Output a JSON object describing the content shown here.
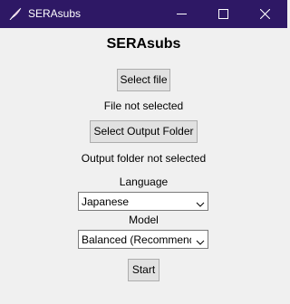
{
  "window": {
    "title": "SERAsubs"
  },
  "main": {
    "heading": "SERAsubs",
    "select_file_label": "Select file",
    "file_status": "File not selected",
    "select_output_label": "Select Output Folder",
    "output_status": "Output folder not selected",
    "language_label": "Language",
    "language_value": "Japanese",
    "model_label": "Model",
    "model_value": "Balanced (Recommended)",
    "start_label": "Start"
  },
  "colors": {
    "titlebar": "#2e1865",
    "window_bg": "#f0f0f0",
    "button_bg": "#e1e1e1"
  },
  "icons": [
    "feather-icon",
    "minimize-icon",
    "maximize-icon",
    "close-icon",
    "chevron-down-icon"
  ]
}
